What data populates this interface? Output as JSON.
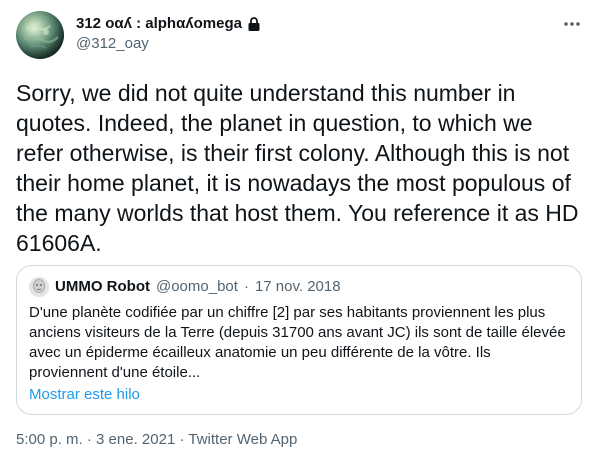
{
  "author": {
    "display_name": "312 οαʎ : alphαʎomega",
    "handle": "@312_oay",
    "avatar_icon": "planet-avatar",
    "protected_icon": "lock-icon"
  },
  "tweet": {
    "text": "Sorry, we did not quite understand this number in quotes. Indeed, the planet in question, to which we refer otherwise, is their first colony. Although this is not their home planet, it is nowadays the most populous of the many worlds that host them. You reference it as HD 61606A.",
    "more_icon": "more-horizontal-icon"
  },
  "quoted_tweet": {
    "display_name": "UMMO Robot",
    "handle": "@oomo_bot",
    "separator": "·",
    "date": "17 nov. 2018",
    "text": "D'une planète codifiée par un chiffre [2] par ses habitants proviennent les plus anciens visiteurs de la Terre (depuis 31700 ans avant JC) ils sont de taille élevée avec un épiderme écailleux anatomie un peu différente de la vôtre. Ils proviennent d'une étoile...",
    "show_thread_label": "Mostrar este hilo"
  },
  "footer": {
    "time": "5:00 p. m.",
    "separator": "·",
    "date": "3 ene. 2021",
    "source": "Twitter Web App"
  },
  "colors": {
    "link": "#1d9bf0",
    "secondary_text": "#536471",
    "border": "#cfd9de"
  }
}
